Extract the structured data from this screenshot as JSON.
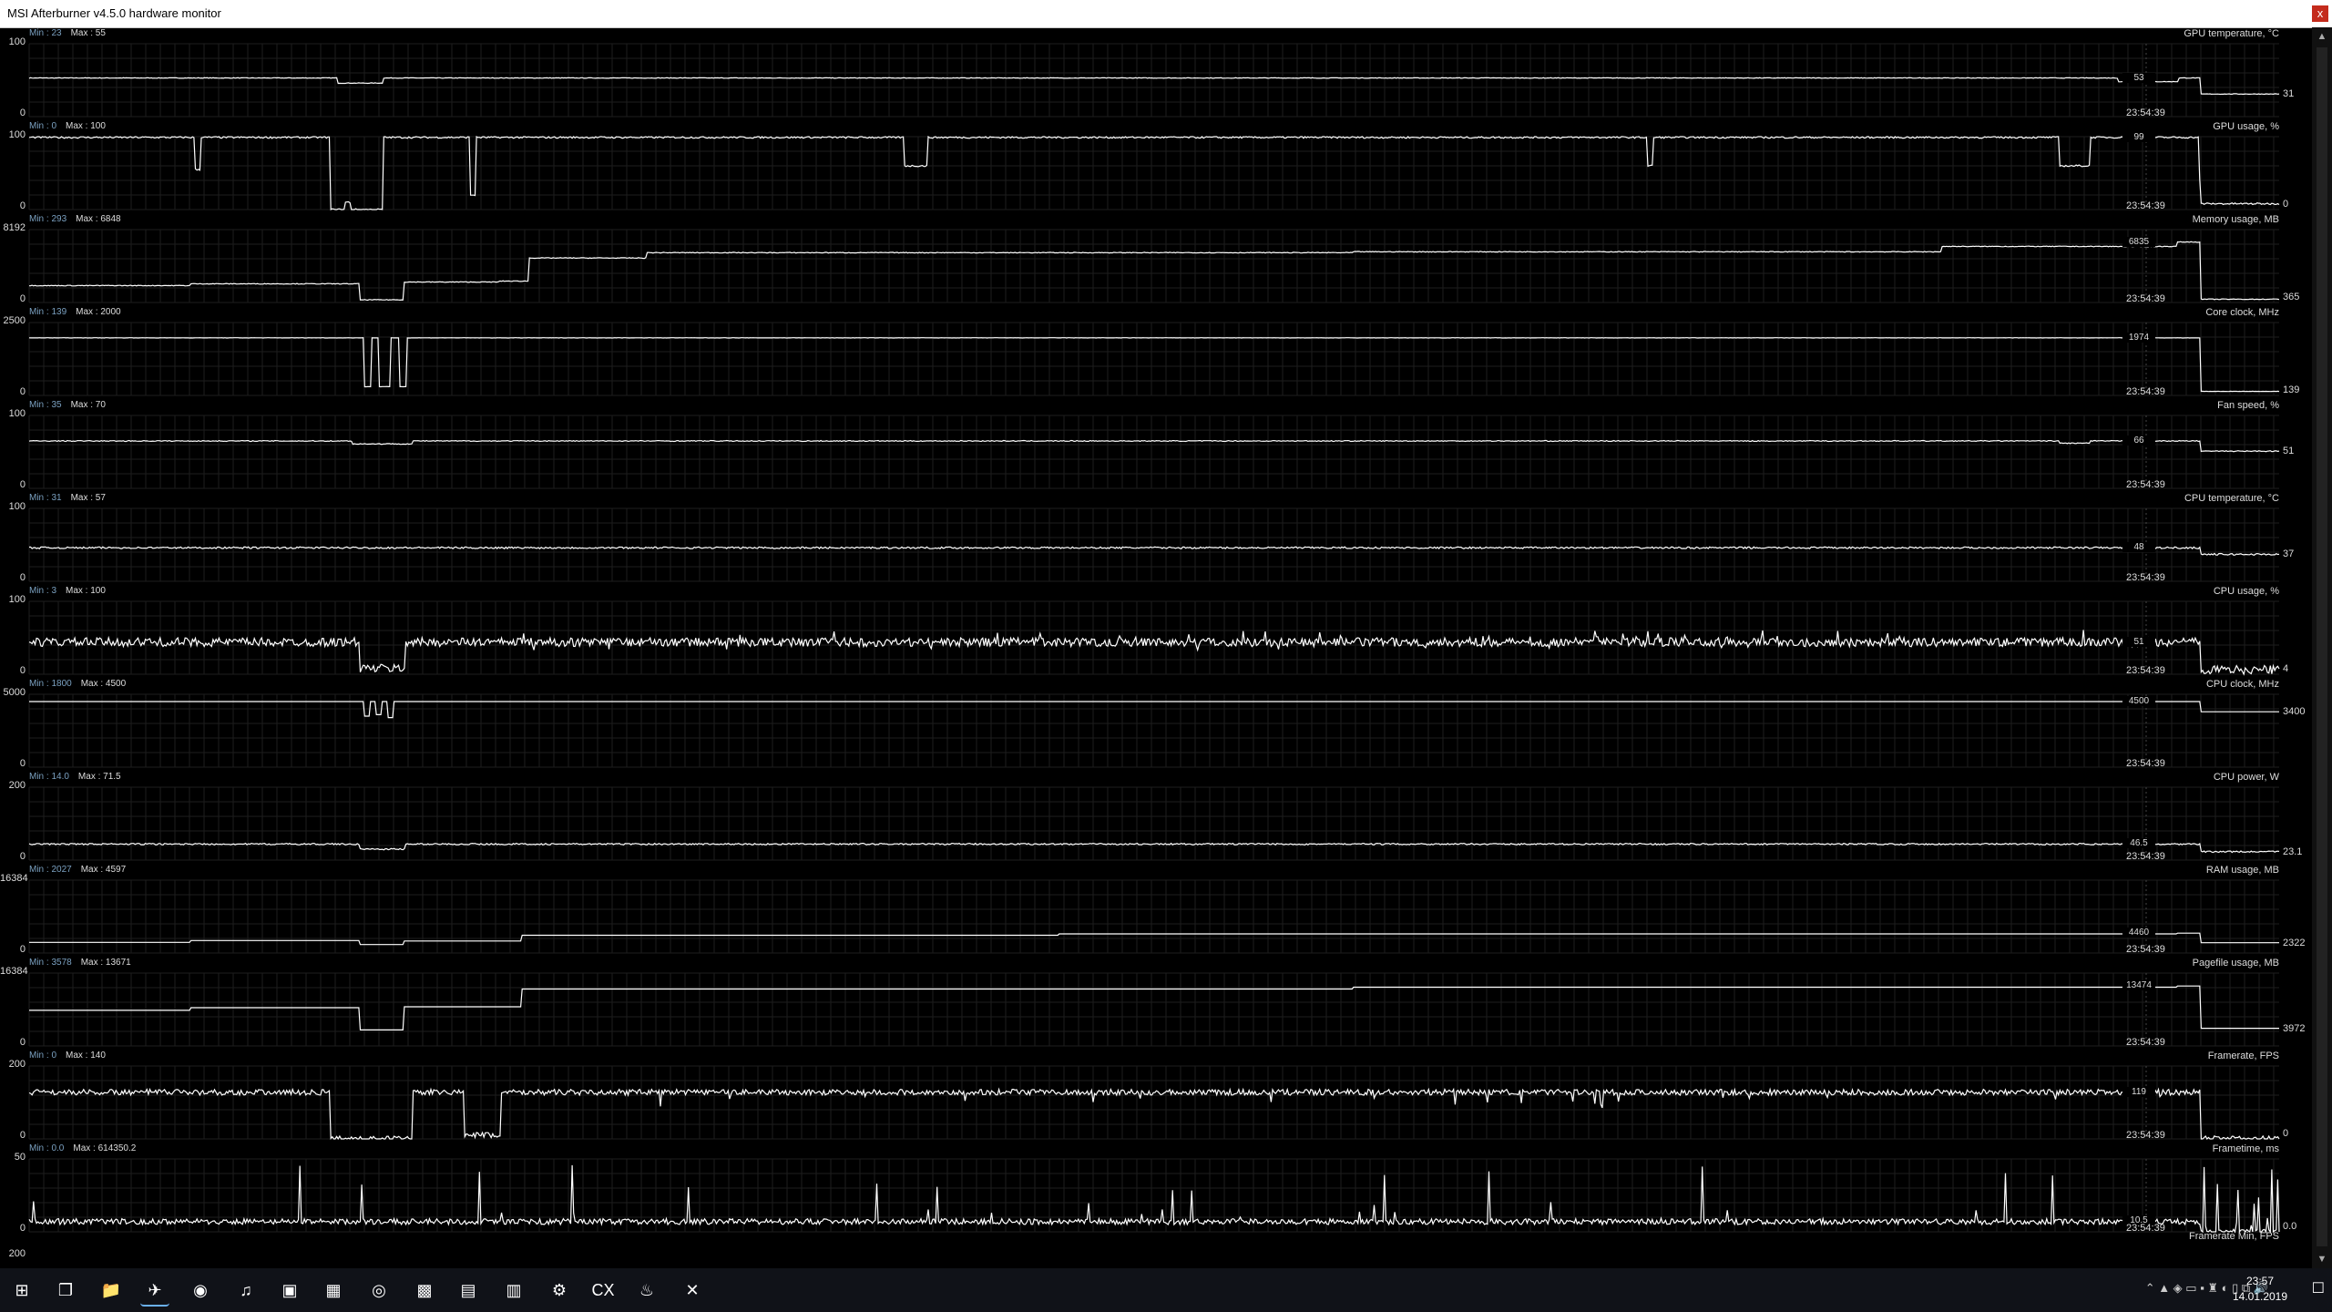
{
  "window": {
    "title": "MSI Afterburner v4.5.0 hardware monitor",
    "close_label": "x"
  },
  "colors": {
    "background": "#000000",
    "grid": "#1e1e1e",
    "line": "#ffffff",
    "min_label": "#7aa0c0"
  },
  "graphs": [
    {
      "name": "GPU temperature, °C",
      "min_text": "Min : 23",
      "max_text": "Max : 55",
      "ymax": "100",
      "ymin": "0",
      "cursor_value": "53",
      "time": "23:54:39",
      "last_value": "31",
      "lo": 0,
      "hi": 100,
      "style": "flat",
      "base": 53,
      "drops": [
        [
          210,
          240,
          46
        ],
        [
          1420,
          1460,
          48
        ]
      ],
      "tail": 31,
      "noise": 0.4
    },
    {
      "name": "GPU usage, %",
      "min_text": "Min : 0",
      "max_text": "Max : 100",
      "ymax": "100",
      "ymin": "0",
      "cursor_value": "99",
      "time": "23:54:39",
      "last_value": "0",
      "lo": 0,
      "hi": 100,
      "style": "flat",
      "base": 99,
      "drops": [
        [
          205,
          240,
          0
        ],
        [
          113,
          116,
          55
        ],
        [
          215,
          218,
          10
        ],
        [
          300,
          303,
          20
        ],
        [
          595,
          610,
          60
        ],
        [
          1100,
          1103,
          60
        ],
        [
          1380,
          1400,
          60
        ],
        [
          1475,
          1478,
          40
        ]
      ],
      "tail": 8,
      "noise": 1.2
    },
    {
      "name": "Memory usage, MB",
      "min_text": "Min : 293",
      "max_text": "Max : 6848",
      "ymax": "8192",
      "ymin": "0",
      "cursor_value": "6835",
      "time": "23:54:39",
      "last_value": "365",
      "lo": 0,
      "hi": 8192,
      "style": "ramp",
      "base": 1800,
      "steps": [
        [
          0,
          1900
        ],
        [
          110,
          2100
        ],
        [
          225,
          300
        ],
        [
          255,
          2300
        ],
        [
          320,
          2400
        ],
        [
          340,
          5000
        ],
        [
          420,
          5600
        ],
        [
          900,
          5700
        ],
        [
          1300,
          6300
        ],
        [
          1460,
          6800
        ]
      ],
      "tail": 365,
      "noise": 40
    },
    {
      "name": "Core clock, MHz",
      "min_text": "Min : 139",
      "max_text": "Max : 2000",
      "ymax": "2500",
      "ymin": "0",
      "cursor_value": "1974",
      "time": "23:54:39",
      "last_value": "139",
      "lo": 0,
      "hi": 2500,
      "style": "flat",
      "base": 1974,
      "drops": [
        [
          228,
          232,
          300
        ],
        [
          238,
          245,
          300
        ],
        [
          252,
          256,
          300
        ]
      ],
      "tail": 139,
      "noise": 5
    },
    {
      "name": "Fan speed, %",
      "min_text": "Min : 35",
      "max_text": "Max : 70",
      "ymax": "100",
      "ymin": "0",
      "cursor_value": "66",
      "time": "23:54:39",
      "last_value": "51",
      "lo": 0,
      "hi": 100,
      "style": "flat",
      "base": 65,
      "drops": [
        [
          220,
          260,
          61
        ],
        [
          1380,
          1400,
          62
        ]
      ],
      "tail": 51,
      "noise": 0.6
    },
    {
      "name": "CPU temperature, °C",
      "min_text": "Min : 31",
      "max_text": "Max : 57",
      "ymax": "100",
      "ymin": "0",
      "cursor_value": "48",
      "time": "23:54:39",
      "last_value": "37",
      "lo": 0,
      "hi": 100,
      "style": "flat",
      "base": 46,
      "drops": [],
      "tail": 37,
      "noise": 1.2
    },
    {
      "name": "CPU usage, %",
      "min_text": "Min : 3",
      "max_text": "Max : 100",
      "ymax": "100",
      "ymin": "0",
      "cursor_value": "51",
      "time": "23:54:39",
      "last_value": "4",
      "lo": 0,
      "hi": 100,
      "style": "noisy",
      "base": 44,
      "drops": [
        [
          225,
          255,
          8
        ]
      ],
      "tail": 6,
      "noise": 6
    },
    {
      "name": "CPU clock, MHz",
      "min_text": "Min : 1800",
      "max_text": "Max : 4500",
      "ymax": "5000",
      "ymin": "0",
      "cursor_value": "4500",
      "time": "23:54:39",
      "last_value": "3400",
      "lo": 0,
      "hi": 5000,
      "style": "flat",
      "base": 4500,
      "drops": [
        [
          228,
          231,
          3500
        ],
        [
          236,
          239,
          3600
        ],
        [
          244,
          247,
          3400
        ]
      ],
      "tail": 3800,
      "noise": 0
    },
    {
      "name": "CPU power, W",
      "min_text": "Min : 14.0",
      "max_text": "Max : 71.5",
      "ymax": "200",
      "ymin": "0",
      "cursor_value": "46.5",
      "time": "23:54:39",
      "last_value": "23.1",
      "lo": 0,
      "hi": 200,
      "style": "flat",
      "base": 44,
      "drops": [
        [
          225,
          255,
          30
        ]
      ],
      "tail": 23,
      "noise": 2
    },
    {
      "name": "RAM usage, MB",
      "min_text": "Min : 2027",
      "max_text": "Max : 4597",
      "ymax": "16384",
      "ymin": "0",
      "cursor_value": "4460",
      "time": "23:54:39",
      "last_value": "2322",
      "lo": 0,
      "hi": 16384,
      "style": "ramp",
      "base": 2400,
      "steps": [
        [
          0,
          2400
        ],
        [
          110,
          2800
        ],
        [
          225,
          1900
        ],
        [
          255,
          2700
        ],
        [
          335,
          4000
        ],
        [
          700,
          4300
        ],
        [
          1460,
          4460
        ]
      ],
      "tail": 2322,
      "noise": 0
    },
    {
      "name": "Pagefile usage, MB",
      "min_text": "Min : 3578",
      "max_text": "Max : 13671",
      "ymax": "16384",
      "ymin": "0",
      "cursor_value": "13474",
      "time": "23:54:39",
      "last_value": "3972",
      "lo": 0,
      "hi": 16384,
      "style": "ramp",
      "base": 8000,
      "steps": [
        [
          0,
          8000
        ],
        [
          110,
          8600
        ],
        [
          225,
          3600
        ],
        [
          255,
          8800
        ],
        [
          335,
          12800
        ],
        [
          900,
          13200
        ],
        [
          1460,
          13474
        ]
      ],
      "tail": 3972,
      "noise": 0
    },
    {
      "name": "Framerate, FPS",
      "min_text": "Min : 0",
      "max_text": "Max : 140",
      "ymax": "200",
      "ymin": "0",
      "cursor_value": "119",
      "time": "23:54:39",
      "last_value": "0",
      "lo": 0,
      "hi": 200,
      "style": "fps",
      "base": 128,
      "drops": [
        [
          205,
          260,
          0
        ],
        [
          296,
          320,
          10
        ]
      ],
      "tail": 0,
      "noise": 8
    },
    {
      "name": "Frametime, ms",
      "min_text": "Min : 0.0",
      "max_text": "Max : 614350.2",
      "ymax": "50",
      "ymin": "0",
      "cursor_value": "10.5",
      "time": "23:54:39",
      "last_value": "0.0",
      "lo": 0,
      "hi": 50,
      "style": "spiky",
      "base": 7,
      "drops": [],
      "tail": 0,
      "noise": 2
    }
  ],
  "extra_row": {
    "name": "Framerate Min, FPS",
    "ymax": "200"
  },
  "taskbar": {
    "icons": [
      {
        "name": "start-icon",
        "glyph": "⊞"
      },
      {
        "name": "task-view-icon",
        "glyph": "❐"
      },
      {
        "name": "file-explorer-icon",
        "glyph": "📁"
      },
      {
        "name": "msi-afterburner-icon",
        "glyph": "✈"
      },
      {
        "name": "firefox-icon",
        "glyph": "◉"
      },
      {
        "name": "spotify-icon",
        "glyph": "♫"
      },
      {
        "name": "app-icon",
        "glyph": "▣"
      },
      {
        "name": "calculator-icon",
        "glyph": "▦"
      },
      {
        "name": "app-circle-icon",
        "glyph": "◎"
      },
      {
        "name": "app-grid-icon",
        "glyph": "▩"
      },
      {
        "name": "app-box-icon",
        "glyph": "▤"
      },
      {
        "name": "app-terminal-icon",
        "glyph": "▥"
      },
      {
        "name": "settings-gear-icon",
        "glyph": "⚙"
      },
      {
        "name": "cx-icon",
        "glyph": "CX"
      },
      {
        "name": "steam-icon",
        "glyph": "♨"
      },
      {
        "name": "xbox-icon",
        "glyph": "✕"
      }
    ],
    "tray_icons": "⌃ ▲ ◈ ▭ ▪ ♜ ◐ ▯ ⧉ 🔊",
    "clock_time": "23:57",
    "clock_date": "14.01.2019",
    "notify_glyph": "☐"
  }
}
